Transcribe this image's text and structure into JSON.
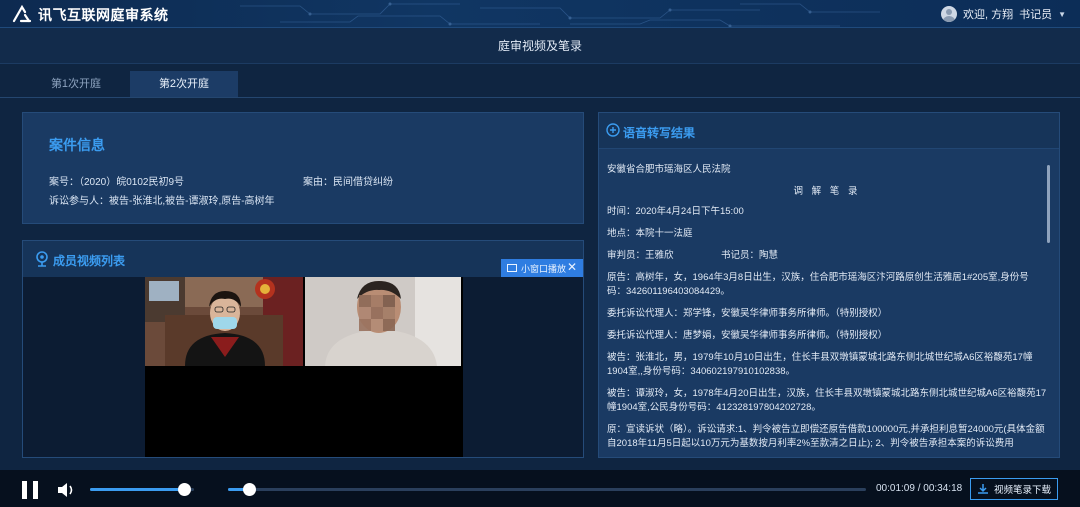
{
  "topbar": {
    "app_title": "讯飞互联网庭审系统",
    "welcome": "欢迎, 方翔",
    "role": "书记员"
  },
  "page": {
    "title": "庭审视频及笔录"
  },
  "tabs": [
    {
      "label": "第1次开庭",
      "active": false
    },
    {
      "label": "第2次开庭",
      "active": true
    }
  ],
  "case_info": {
    "title": "案件信息",
    "case_no_label": "案号：",
    "case_no": "（2020）皖0102民初9号",
    "cause_label": "案由：",
    "cause": "民间借贷纠纷",
    "parties_label": "诉讼参与人：",
    "parties": "被告-张淮北,被告-谭淑玲,原告-高树年"
  },
  "video_list": {
    "title": "成员视频列表",
    "popout_label": "小窗口播放"
  },
  "transcript": {
    "title": "语音转写结果",
    "court": "安徽省合肥市瑶海区人民法院",
    "heading": "调 解 笔 录",
    "lines": [
      "时间：2020年4月24日下午15:00",
      "地点：本院十一法庭",
      "审判员：王雅欣　　　　　书记员：陶慧",
      "原告：高树年，女，1964年3月8日出生，汉族，住合肥市瑶海区汴河路原创生活雅居1#205室,身份号码：342601196403084429。",
      "委托诉讼代理人：郑学锋，安徽吴华律师事务所律师。（特别授权）",
      "委托诉讼代理人：唐梦娟，安徽吴华律师事务所律师。（特别授权）",
      "被告：张淮北，男，1979年10月10日出生，住长丰县双墩镇蒙城北路东侧北城世纪城A6区裕馥苑17幢1904室,,身份号码：340602197910102838。",
      "被告：谭淑玲，女，1978年4月20日出生，汉族，住长丰县双墩镇蒙城北路东侧北城世纪城A6区裕馥苑17幢1904室,公民身份号码：412328197804202728。",
      "原：宣读诉状（略）。诉讼请求:1、判令被告立即偿还原告借款100000元,并承担利息暂24000元(具体金额自2018年11月5日起以10万元为基数按月利率2%至款清之日止); 2、判令被告承担本案的诉讼费用"
    ]
  },
  "player": {
    "state": "playing",
    "volume": 0.9,
    "progress": 0.033,
    "current_time": "00:01:09",
    "total_time": "00:34:18",
    "time_display": "00:01:09 / 00:34:18",
    "download_label": "视频笔录下载"
  },
  "colors": {
    "accent": "#3b9cf0",
    "background": "#0f2541",
    "panel": "#1a3a63"
  }
}
